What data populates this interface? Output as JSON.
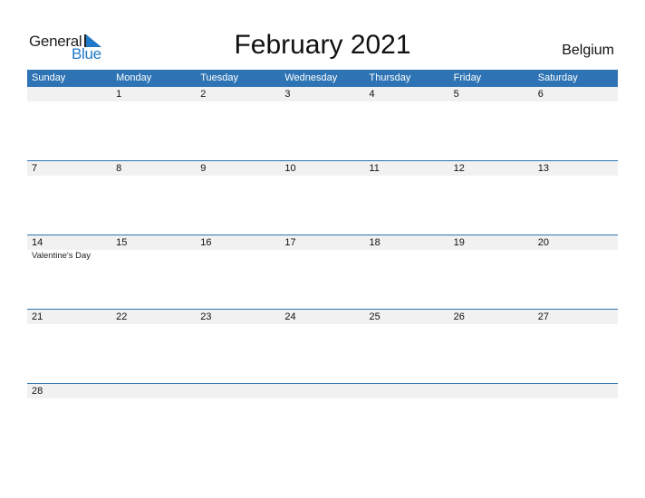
{
  "logo": {
    "general": "General",
    "blue": "Blue"
  },
  "title": "February 2021",
  "country": "Belgium",
  "colors": {
    "header": "#2e74b5",
    "strip": "#f1f1f1",
    "brand": "#1f78c8"
  },
  "weekdays": [
    "Sunday",
    "Monday",
    "Tuesday",
    "Wednesday",
    "Thursday",
    "Friday",
    "Saturday"
  ],
  "weeks": [
    {
      "days": [
        "",
        "1",
        "2",
        "3",
        "4",
        "5",
        "6"
      ],
      "events": [
        "",
        "",
        "",
        "",
        "",
        "",
        ""
      ]
    },
    {
      "days": [
        "7",
        "8",
        "9",
        "10",
        "11",
        "12",
        "13"
      ],
      "events": [
        "",
        "",
        "",
        "",
        "",
        "",
        ""
      ]
    },
    {
      "days": [
        "14",
        "15",
        "16",
        "17",
        "18",
        "19",
        "20"
      ],
      "events": [
        "Valentine's Day",
        "",
        "",
        "",
        "",
        "",
        ""
      ]
    },
    {
      "days": [
        "21",
        "22",
        "23",
        "24",
        "25",
        "26",
        "27"
      ],
      "events": [
        "",
        "",
        "",
        "",
        "",
        "",
        ""
      ]
    },
    {
      "days": [
        "28",
        "",
        "",
        "",
        "",
        "",
        ""
      ],
      "events": [
        "",
        "",
        "",
        "",
        "",
        "",
        ""
      ]
    }
  ]
}
